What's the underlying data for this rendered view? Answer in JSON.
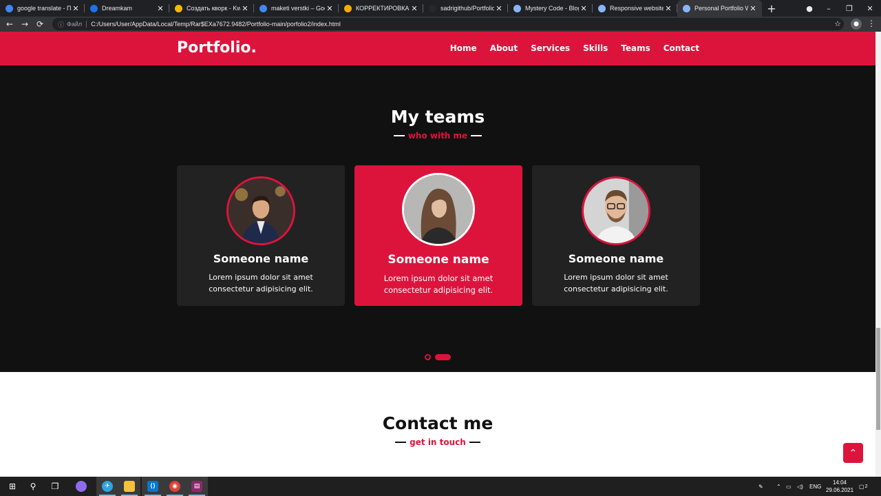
{
  "browser": {
    "tabs": [
      {
        "title": "google translate - Пои",
        "favicon": "google-icon",
        "color": "#4285f4"
      },
      {
        "title": "Dreamkam",
        "favicon": "dreamkam-icon",
        "color": "#1a73e8"
      },
      {
        "title": "Создать кворк - Kwork",
        "favicon": "kwork-icon",
        "color": "#f5b800"
      },
      {
        "title": "maketi verstki – Google",
        "favicon": "google-icon",
        "color": "#4285f4"
      },
      {
        "title": "КОРРЕКТИРОВКА, КОР",
        "favicon": "chart-icon",
        "color": "#f9ab00"
      },
      {
        "title": "sadrigithub/Portfolio",
        "favicon": "github-icon",
        "color": "#24292e"
      },
      {
        "title": "Mystery Code - Blog",
        "favicon": "globe-icon",
        "color": "#8ab4f8"
      },
      {
        "title": "Responsive website fo",
        "favicon": "globe-icon",
        "color": "#8ab4f8"
      },
      {
        "title": "Personal Portfolio Web",
        "favicon": "globe-icon",
        "color": "#8ab4f8",
        "active": true
      }
    ],
    "address": {
      "info_label": "Файл",
      "url": "C:/Users/User/AppData/Local/Temp/Rar$EXa7672.9482/Portfolio-main/porfolio2/index.html"
    }
  },
  "page": {
    "brand": {
      "text": "Portfolio",
      "dot": "."
    },
    "nav": [
      "Home",
      "About",
      "Services",
      "Skills",
      "Teams",
      "Contact"
    ],
    "teams_section": {
      "title": "My teams",
      "subtitle": "who with me",
      "cards": [
        {
          "name": "Someone name",
          "text_line1": "Lorem ipsum dolor sit amet",
          "text_line2": "consectetur adipisicing elit."
        },
        {
          "name": "Someone name",
          "text_line1": "Lorem ipsum dolor sit amet",
          "text_line2": "consectetur adipisicing elit."
        },
        {
          "name": "Someone name",
          "text_line1": "Lorem ipsum dolor sit amet",
          "text_line2": "consectetur adipisicing elit."
        }
      ],
      "active_card_index": 1,
      "carousel_pages": 2,
      "carousel_active_page": 2
    },
    "contact_section": {
      "title": "Contact me",
      "subtitle": "get in touch"
    },
    "colors": {
      "accent": "#dc143c",
      "dark_bg": "#111111",
      "card_bg": "#222222"
    }
  },
  "taskbar": {
    "lang": "ENG",
    "time": "14:04",
    "date": "29.06.2021",
    "notification_count": "2"
  }
}
